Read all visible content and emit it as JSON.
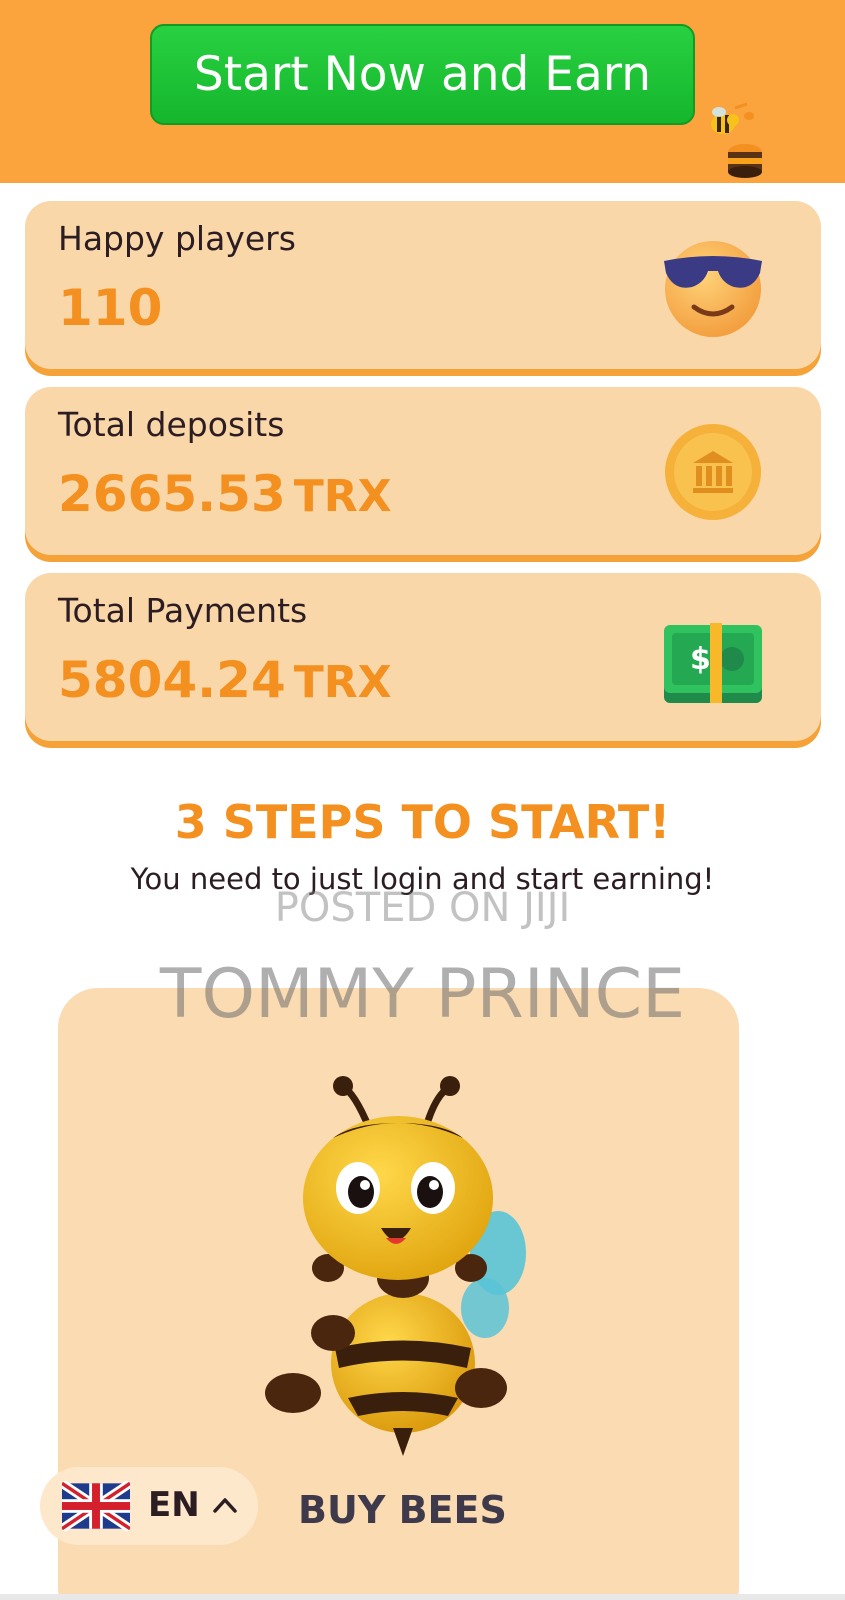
{
  "header": {
    "cta_label": "Start Now and Earn",
    "bg_color": "#fba33c",
    "cta_color": "#1fc638"
  },
  "stats": [
    {
      "label": "Happy players",
      "value": "110",
      "unit": "",
      "icon": "sunglasses-smiley-icon"
    },
    {
      "label": "Total deposits",
      "value": "2665.53",
      "unit": "TRX",
      "icon": "bank-coin-icon"
    },
    {
      "label": "Total Payments",
      "value": "5804.24",
      "unit": "TRX",
      "icon": "money-bill-icon"
    }
  ],
  "steps": {
    "title": "3 STEPS TO START!",
    "subtitle": "You need to just login and start earning!"
  },
  "watermark": {
    "line1": "POSTED ON JIJI",
    "line2": "TOMMY PRINCE"
  },
  "bee_card": {
    "label": "BUY BEES",
    "icon": "bee-mascot-icon"
  },
  "language": {
    "code": "EN",
    "icon": "uk-flag-icon"
  }
}
